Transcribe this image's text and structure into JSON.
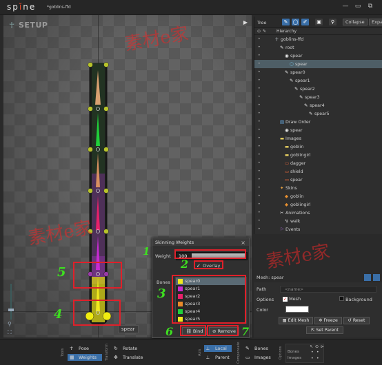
{
  "app": {
    "logo": "spine",
    "doc_title": "*goblins-ffd"
  },
  "window": {
    "minimize": "—",
    "restore": "▭",
    "close": "⧉"
  },
  "viewport": {
    "mode_label": "SETUP",
    "play_icon": "▶",
    "selected_tag": "spear"
  },
  "watermarks": [
    "素材e家",
    "素材e家",
    "素材e家"
  ],
  "skinning": {
    "title": "Skinning Weights",
    "close": "×",
    "weight_label": "Weight",
    "weight_value": "100",
    "overlay_label": "Overlay",
    "overlay_checked": true,
    "bones_label": "Bones",
    "bones": [
      {
        "name": "spear0",
        "color": "#f0e81e",
        "selected": true
      },
      {
        "name": "spear1",
        "color": "#c82ad2"
      },
      {
        "name": "spear2",
        "color": "#e8206a"
      },
      {
        "name": "spear3",
        "color": "#e88a2a"
      },
      {
        "name": "spear4",
        "color": "#20d03a"
      },
      {
        "name": "spear5",
        "color": "#f0e81e"
      }
    ],
    "bind_label": "Bind",
    "remove_label": "Remove"
  },
  "annotations": [
    "1",
    "2",
    "3",
    "4",
    "5",
    "6",
    "7"
  ],
  "tree": {
    "title": "Tree",
    "collapse_label": "Collapse",
    "expand_label": "Expa",
    "hierarchy_label": "Hierarchy",
    "rows": [
      {
        "label": "goblins-ffd",
        "indent": 0,
        "icon": "skeleton"
      },
      {
        "label": "root",
        "indent": 1,
        "icon": "bone"
      },
      {
        "label": "spear",
        "indent": 2,
        "icon": "slot"
      },
      {
        "label": "spear",
        "indent": 3,
        "icon": "mesh",
        "selected": true
      },
      {
        "label": "spear0",
        "indent": 2,
        "icon": "bone"
      },
      {
        "label": "spear1",
        "indent": 3,
        "icon": "bone"
      },
      {
        "label": "spear2",
        "indent": 4,
        "icon": "bone"
      },
      {
        "label": "spear3",
        "indent": 5,
        "icon": "bone"
      },
      {
        "label": "spear4",
        "indent": 6,
        "icon": "bone"
      },
      {
        "label": "spear5",
        "indent": 7,
        "icon": "bone"
      },
      {
        "label": "Draw Order",
        "indent": 1,
        "icon": "draworder"
      },
      {
        "label": "spear",
        "indent": 2,
        "icon": "slot"
      },
      {
        "label": "Images",
        "indent": 1,
        "icon": "folder"
      },
      {
        "label": "goblin",
        "indent": 2,
        "icon": "folder"
      },
      {
        "label": "goblingirl",
        "indent": 2,
        "icon": "folder"
      },
      {
        "label": "dagger",
        "indent": 2,
        "icon": "image"
      },
      {
        "label": "shield",
        "indent": 2,
        "icon": "image"
      },
      {
        "label": "spear",
        "indent": 2,
        "icon": "image"
      },
      {
        "label": "Skins",
        "indent": 1,
        "icon": "skins"
      },
      {
        "label": "goblin",
        "indent": 2,
        "icon": "skin"
      },
      {
        "label": "goblingirl",
        "indent": 2,
        "icon": "skin"
      },
      {
        "label": "Animations",
        "indent": 1,
        "icon": "animations"
      },
      {
        "label": "walk",
        "indent": 2,
        "icon": "animation"
      },
      {
        "label": "Events",
        "indent": 1,
        "icon": "events"
      }
    ]
  },
  "props": {
    "title": "Mesh: spear",
    "path_label": "Path",
    "path_value": "<name>",
    "options_label": "Options",
    "mesh_label": "Mesh",
    "background_label": "Background",
    "color_label": "Color",
    "edit_mesh_label": "Edit Mesh",
    "freeze_label": "Freeze",
    "reset_label": "Reset",
    "set_parent_label": "Set Parent"
  },
  "toolbar": {
    "tools_label": "Tools",
    "pose_label": "Pose",
    "weights_label": "Weights",
    "transform_label": "Transform",
    "rotate_label": "Rotate",
    "translate_label": "Translate",
    "axis_label": "Axis",
    "local_label": "Local",
    "parent_label": "Parent",
    "compensate_label": "Compensate",
    "bones_label": "Bones",
    "images_label": "Images",
    "options_label": "Options",
    "opt_bones_label": "Bones",
    "opt_images_label": "Images"
  }
}
